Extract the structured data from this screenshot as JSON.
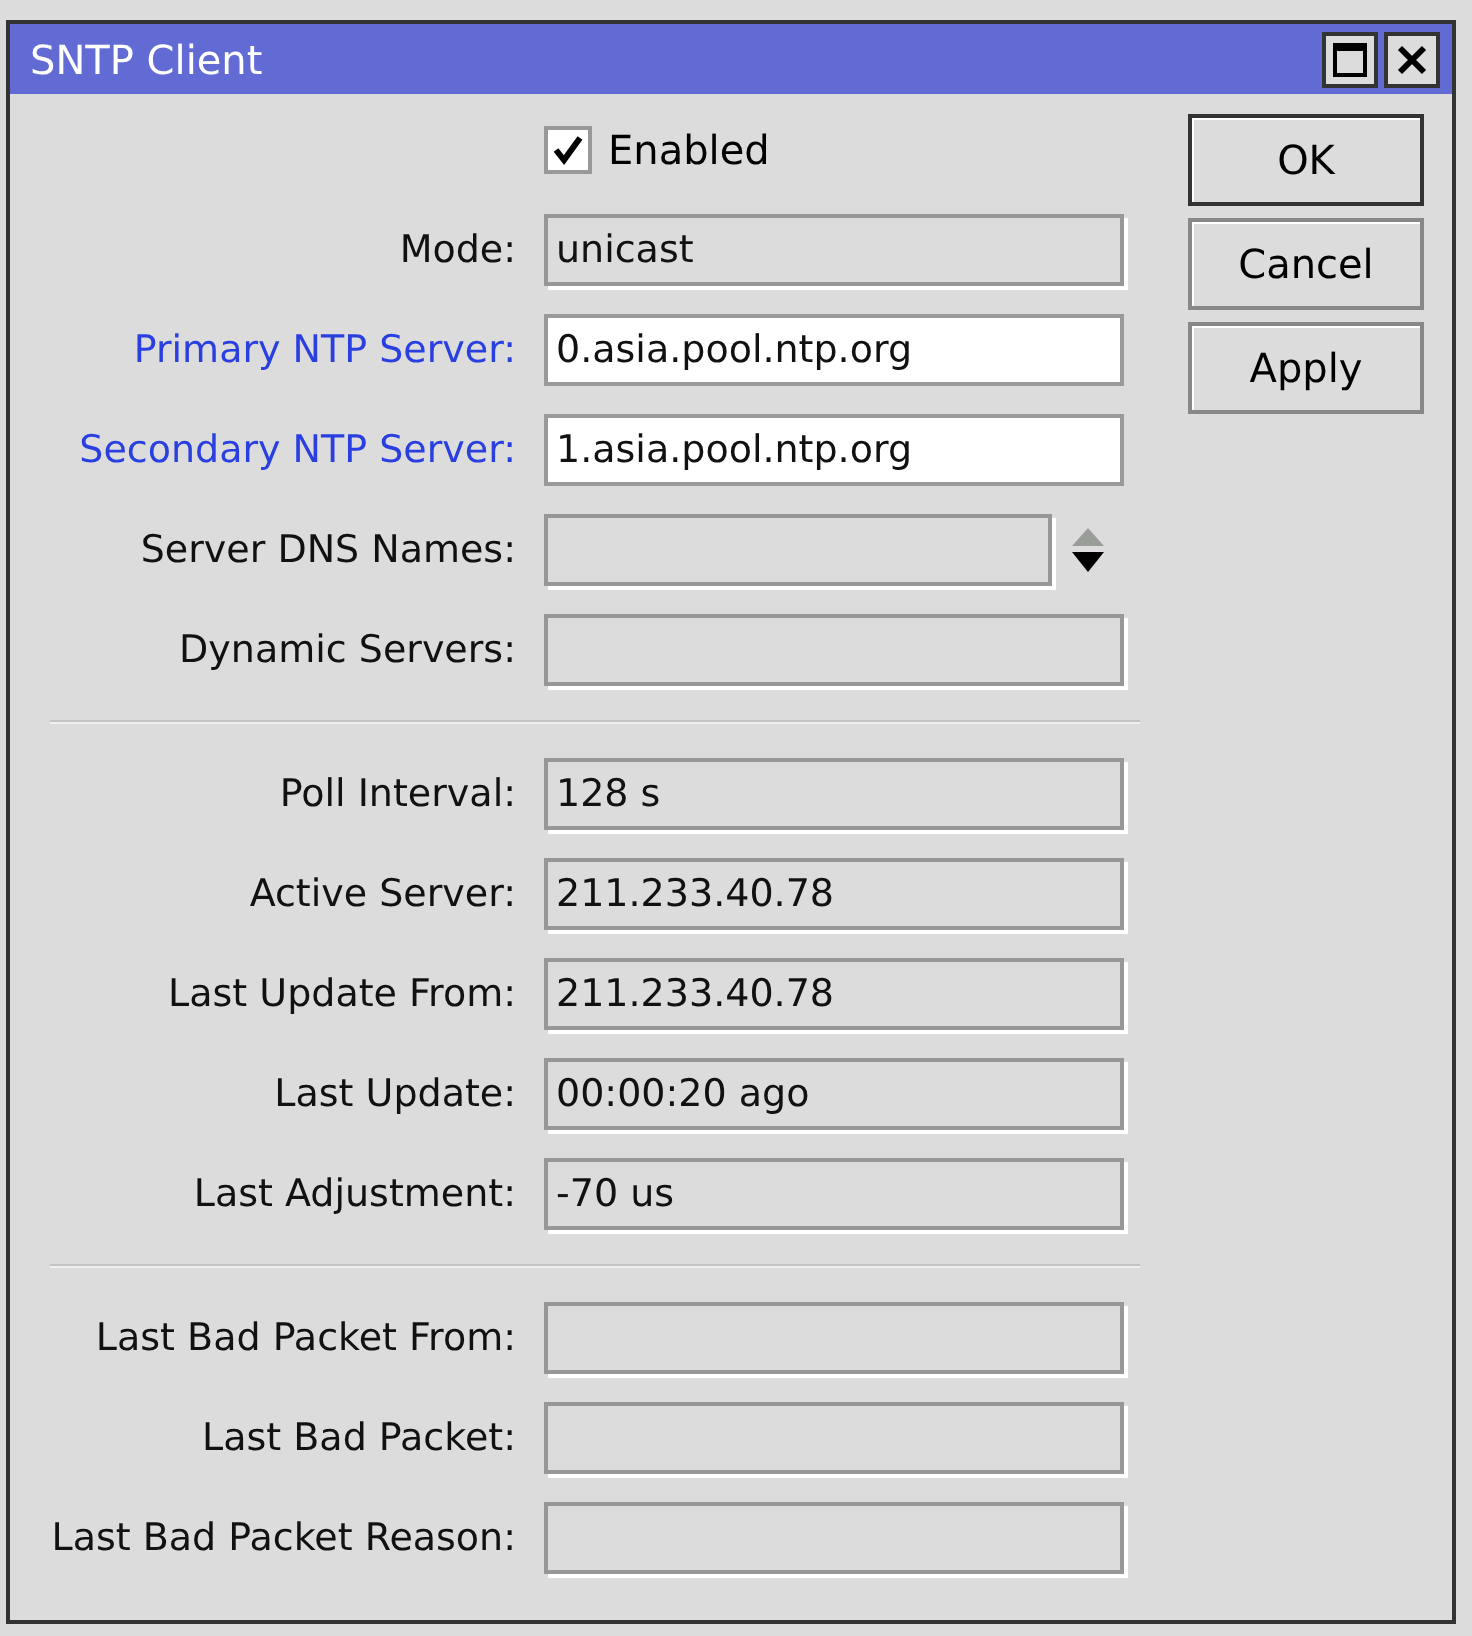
{
  "window": {
    "title": "SNTP Client"
  },
  "enabled": {
    "label": "Enabled",
    "checked": true
  },
  "sections": [
    {
      "rows": [
        {
          "label": "Mode:",
          "value": "unicast",
          "kind": "readonly"
        },
        {
          "label": "Primary NTP Server:",
          "value": "0.asia.pool.ntp.org",
          "kind": "editable"
        },
        {
          "label": "Secondary NTP Server:",
          "value": "1.asia.pool.ntp.org",
          "kind": "editable"
        },
        {
          "label": "Server DNS Names:",
          "kind": "updown"
        },
        {
          "label": "Dynamic Servers:",
          "kind": "readonly"
        }
      ]
    },
    {
      "rows": [
        {
          "label": "Poll Interval:",
          "value": "128 s",
          "kind": "readonly"
        },
        {
          "label": "Active Server:",
          "value": "211.233.40.78",
          "kind": "readonly"
        },
        {
          "label": "Last Update From:",
          "value": "211.233.40.78",
          "kind": "readonly"
        },
        {
          "label": "Last Update:",
          "value": "00:00:20 ago",
          "kind": "readonly"
        },
        {
          "label": "Last Adjustment:",
          "value": "-70 us",
          "kind": "readonly"
        }
      ]
    },
    {
      "rows": [
        {
          "label": "Last Bad Packet From:",
          "kind": "readonly"
        },
        {
          "label": "Last Bad Packet:",
          "kind": "readonly"
        },
        {
          "label": "Last Bad Packet Reason:",
          "kind": "readonly"
        }
      ]
    }
  ],
  "buttons": [
    "OK",
    "Cancel",
    "Apply"
  ]
}
